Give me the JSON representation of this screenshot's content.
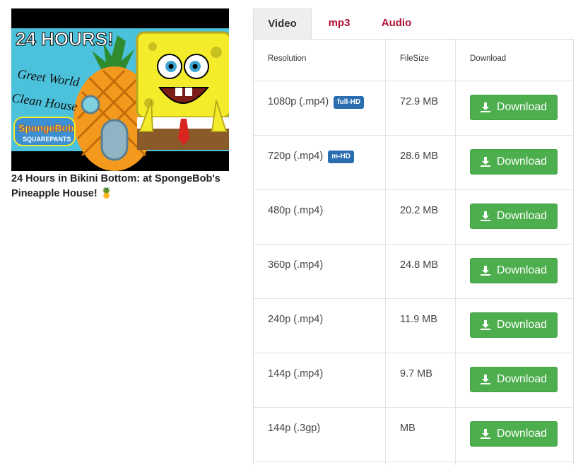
{
  "video": {
    "thumbnail_icon": "spongebob-thumbnail-image",
    "thumbnail_text": {
      "banner": "24 HOURS!",
      "line1": "Greet World",
      "line2": "Clean House",
      "logo_top": "SpongeBob",
      "logo_bottom": "SQUAREPANTS"
    },
    "title": "24 Hours in Bikini Bottom: at SpongeBob's Pineapple House! 🍍"
  },
  "tabs": [
    {
      "label": "Video",
      "active": true
    },
    {
      "label": "mp3",
      "active": false
    },
    {
      "label": "Audio",
      "active": false
    }
  ],
  "table": {
    "headers": {
      "resolution": "Resolution",
      "filesize": "FileSize",
      "download": "Download"
    },
    "rows": [
      {
        "resolution": "1080p (.mp4)",
        "badge": "full-HD",
        "size": "72.9 MB",
        "button": "Download"
      },
      {
        "resolution": "720p (.mp4)",
        "badge": "m-HD",
        "size": "28.6 MB",
        "button": "Download"
      },
      {
        "resolution": "480p (.mp4)",
        "badge": "",
        "size": "20.2 MB",
        "button": "Download"
      },
      {
        "resolution": "360p (.mp4)",
        "badge": "",
        "size": "24.8 MB",
        "button": "Download"
      },
      {
        "resolution": "240p (.mp4)",
        "badge": "",
        "size": "11.9 MB",
        "button": "Download"
      },
      {
        "resolution": "144p (.mp4)",
        "badge": "",
        "size": "9.7 MB",
        "button": "Download"
      },
      {
        "resolution": "144p (.3gp)",
        "badge": "",
        "size": "MB",
        "button": "Download"
      }
    ]
  },
  "colors": {
    "tab_link": "#b01035",
    "download_button": "#4cae4c",
    "badge": "#2a6db0"
  },
  "icons": {
    "download": "download-arrow-icon"
  }
}
